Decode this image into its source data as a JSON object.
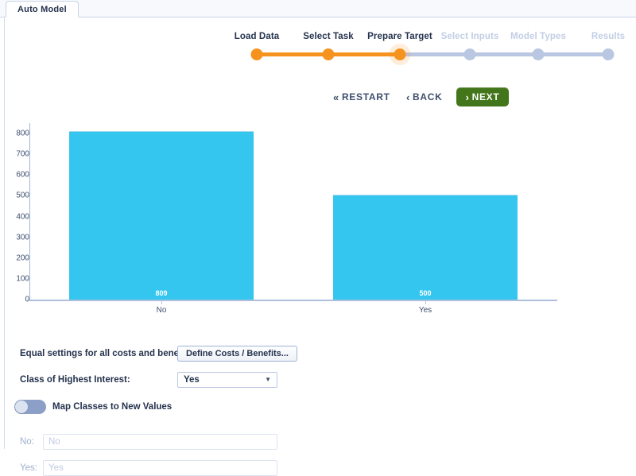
{
  "tab": {
    "label": "Auto Model"
  },
  "stepper": {
    "steps": [
      {
        "label": "Load Data",
        "state": "done"
      },
      {
        "label": "Select Task",
        "state": "done"
      },
      {
        "label": "Prepare Target",
        "state": "active"
      },
      {
        "label": "Select Inputs",
        "state": "todo"
      },
      {
        "label": "Model Types",
        "state": "todo"
      },
      {
        "label": "Results",
        "state": "todo"
      }
    ],
    "active_color": "#f6921e",
    "inactive_color": "#b9c7e2"
  },
  "nav": {
    "restart": {
      "label": "RESTART",
      "icon": "«"
    },
    "back": {
      "label": "BACK",
      "icon": "‹"
    },
    "next": {
      "label": "NEXT",
      "icon": "›",
      "color": "#43761a"
    }
  },
  "chart_data": {
    "type": "bar",
    "title": "",
    "xlabel": "",
    "ylabel": "",
    "categories": [
      "No",
      "Yes"
    ],
    "values": [
      809,
      500
    ],
    "value_labels": [
      "809",
      "500"
    ],
    "ylim": [
      0,
      850
    ],
    "yticks": [
      0,
      100,
      200,
      300,
      400,
      500,
      600,
      700,
      800
    ],
    "ytick_labels": [
      "0",
      "100",
      "200",
      "300",
      "400",
      "500",
      "600",
      "700",
      "800"
    ],
    "grid": false,
    "legend": false,
    "bar_color": "#35c6ef"
  },
  "form": {
    "costs_label": "Equal settings for all costs and benefits.",
    "costs_button": "Define Costs / Benefits...",
    "class_label": "Class of Highest Interest:",
    "class_value": "Yes",
    "class_arrow": "▼",
    "toggle_label": "Map Classes to New Values",
    "toggle_state": "off",
    "map_rows": [
      {
        "label": "No:",
        "value": "",
        "placeholder": "No"
      },
      {
        "label": "Yes:",
        "value": "",
        "placeholder": "Yes"
      }
    ]
  }
}
